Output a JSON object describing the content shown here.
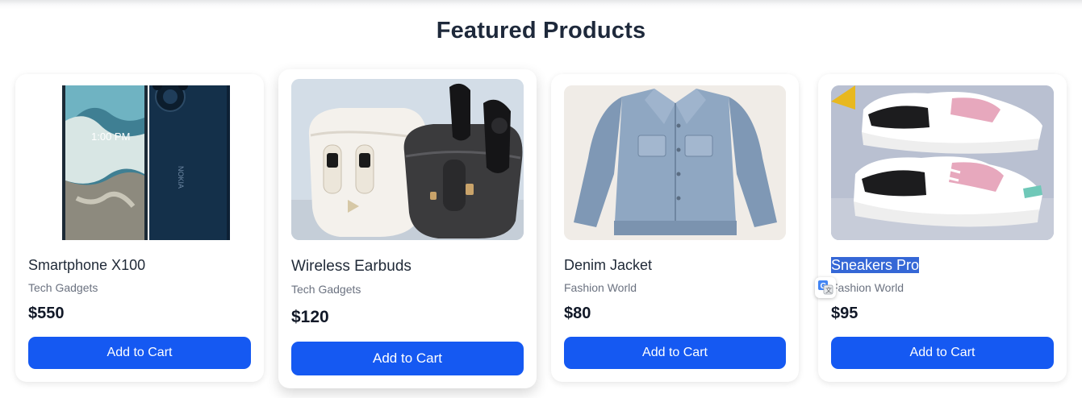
{
  "section": {
    "title": "Featured Products"
  },
  "products": [
    {
      "name": "Smartphone X100",
      "store": "Tech Gadgets",
      "price": "$550",
      "button_label": "Add to Cart",
      "image_icon": "smartphone-image"
    },
    {
      "name": "Wireless Earbuds",
      "store": "Tech Gadgets",
      "price": "$120",
      "button_label": "Add to Cart",
      "image_icon": "earbuds-image"
    },
    {
      "name": "Denim Jacket",
      "store": "Fashion World",
      "price": "$80",
      "button_label": "Add to Cart",
      "image_icon": "jacket-image"
    },
    {
      "name": "Sneakers Pro",
      "store": "Fashion World",
      "price": "$95",
      "button_label": "Add to Cart",
      "image_icon": "sneakers-image"
    }
  ],
  "overlay": {
    "translate_icon": "google-translate-icon"
  },
  "colors": {
    "button": "#1559f2",
    "selection": "#3567d6",
    "title": "#1e293b"
  }
}
